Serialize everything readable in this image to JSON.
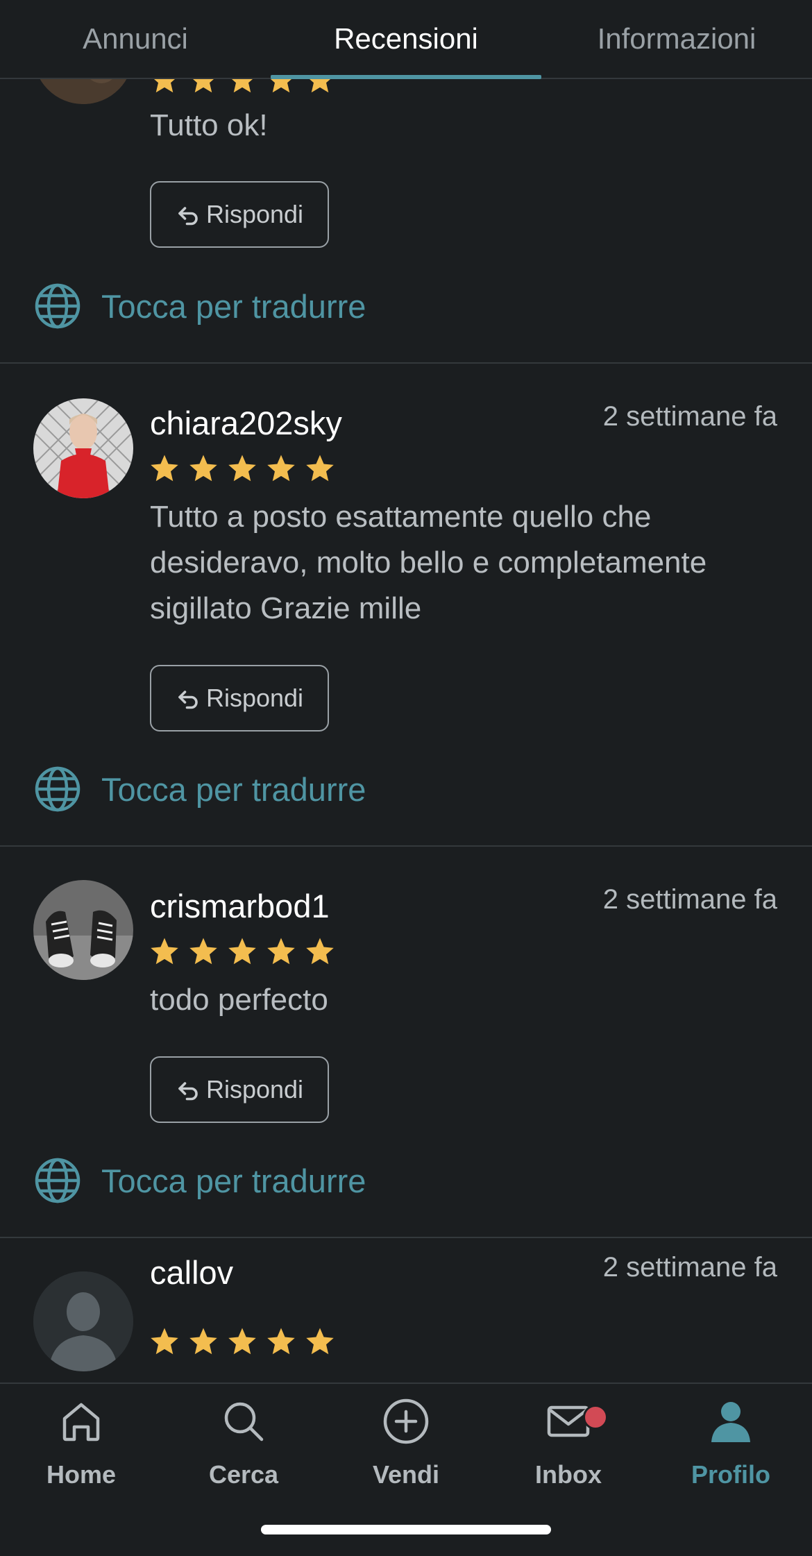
{
  "tabs": [
    {
      "label": "Annunci",
      "active": false
    },
    {
      "label": "Recensioni",
      "active": true
    },
    {
      "label": "Informazioni",
      "active": false
    }
  ],
  "reviews": [
    {
      "username": "",
      "date": "",
      "rating": 5,
      "text": "Tutto ok!",
      "reply_label": "Rispondi",
      "translate_label": "Tocca per tradurre"
    },
    {
      "username": "chiara202sky",
      "date": "2 settimane fa",
      "rating": 5,
      "text": "Tutto a posto esattamente quello che desideravo, molto bello e completamente sigillato Grazie mille",
      "reply_label": "Rispondi",
      "translate_label": "Tocca per tradurre"
    },
    {
      "username": "crismarbod1",
      "date": "2 settimane fa",
      "rating": 5,
      "text": "todo perfecto",
      "reply_label": "Rispondi",
      "translate_label": "Tocca per tradurre"
    },
    {
      "username": "callov",
      "date": "2 settimane fa",
      "rating": 5,
      "text": "",
      "reply_label": "",
      "translate_label": ""
    }
  ],
  "bottom_nav": [
    {
      "label": "Home",
      "icon": "home-icon",
      "active": false
    },
    {
      "label": "Cerca",
      "icon": "search-icon",
      "active": false
    },
    {
      "label": "Vendi",
      "icon": "plus-circle-icon",
      "active": false
    },
    {
      "label": "Inbox",
      "icon": "mail-icon",
      "active": false,
      "has_notification": true
    },
    {
      "label": "Profilo",
      "icon": "profile-icon",
      "active": true
    }
  ],
  "colors": {
    "background": "#1b1e20",
    "accent": "#4f95a3",
    "star": "#f3bd4f",
    "notification": "#d24a55",
    "divider": "#34393c"
  }
}
